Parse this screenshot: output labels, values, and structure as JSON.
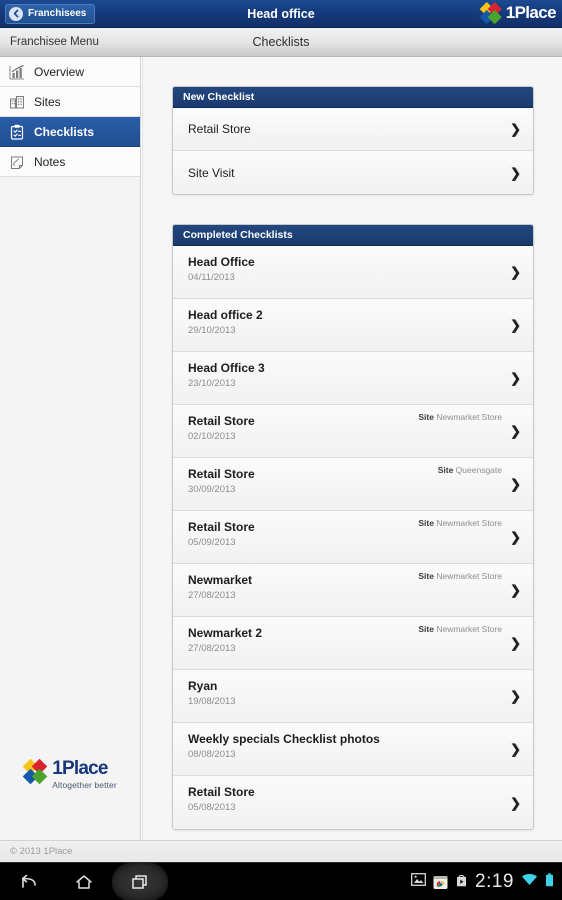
{
  "topbar": {
    "back_label": "Franchisees",
    "title": "Head office",
    "brand_name": "1Place"
  },
  "subbar": {
    "left_label": "Franchisee Menu",
    "center_label": "Checklists"
  },
  "sidebar": {
    "items": [
      {
        "label": "Overview",
        "icon": "chart-icon",
        "active": false
      },
      {
        "label": "Sites",
        "icon": "building-icon",
        "active": false
      },
      {
        "label": "Checklists",
        "icon": "clipboard-icon",
        "active": true
      },
      {
        "label": "Notes",
        "icon": "note-icon",
        "active": false
      }
    ],
    "footer": {
      "brand_name": "1Place",
      "tagline": "Altogether better"
    }
  },
  "content": {
    "new_checklist": {
      "header": "New Checklist",
      "items": [
        {
          "title": "Retail Store"
        },
        {
          "title": "Site Visit"
        }
      ]
    },
    "completed_checklists": {
      "header": "Completed Checklists",
      "items": [
        {
          "title": "Head Office",
          "date": "04/11/2013",
          "site_label": "",
          "site": ""
        },
        {
          "title": "Head office 2",
          "date": "29/10/2013",
          "site_label": "",
          "site": ""
        },
        {
          "title": "Head Office 3",
          "date": "23/10/2013",
          "site_label": "",
          "site": ""
        },
        {
          "title": "Retail Store",
          "date": "02/10/2013",
          "site_label": "Site",
          "site": "Newmarket Store"
        },
        {
          "title": "Retail Store",
          "date": "30/09/2013",
          "site_label": "Site",
          "site": "Queensgate"
        },
        {
          "title": "Retail Store",
          "date": "05/09/2013",
          "site_label": "Site",
          "site": "Newmarket Store"
        },
        {
          "title": "Newmarket",
          "date": "27/08/2013",
          "site_label": "Site",
          "site": "Newmarket Store"
        },
        {
          "title": "Newmarket 2",
          "date": "27/08/2013",
          "site_label": "Site",
          "site": "Newmarket Store"
        },
        {
          "title": "Ryan",
          "date": "19/08/2013",
          "site_label": "",
          "site": ""
        },
        {
          "title": "Weekly specials Checklist photos",
          "date": "08/08/2013",
          "site_label": "",
          "site": ""
        },
        {
          "title": "Retail Store",
          "date": "05/08/2013",
          "site_label": "",
          "site": ""
        }
      ]
    }
  },
  "copyright": "© 2013 1Place",
  "navbar": {
    "back_icon": "back-arrow-icon",
    "home_icon": "home-icon",
    "recents_icon": "recent-apps-icon",
    "clock": "2:19",
    "status_icons": [
      "screenshot-icon",
      "photos-app-icon",
      "play-store-icon",
      "wifi-icon",
      "battery-icon"
    ]
  },
  "colors": {
    "brand_navy": "#17377a",
    "header_blue": "#1a3a6e",
    "active_blue": "#1f4e92",
    "logo_yellow": "#f5c518",
    "logo_red": "#d9232e",
    "logo_blue": "#1557a8",
    "logo_green": "#4aa32e"
  }
}
